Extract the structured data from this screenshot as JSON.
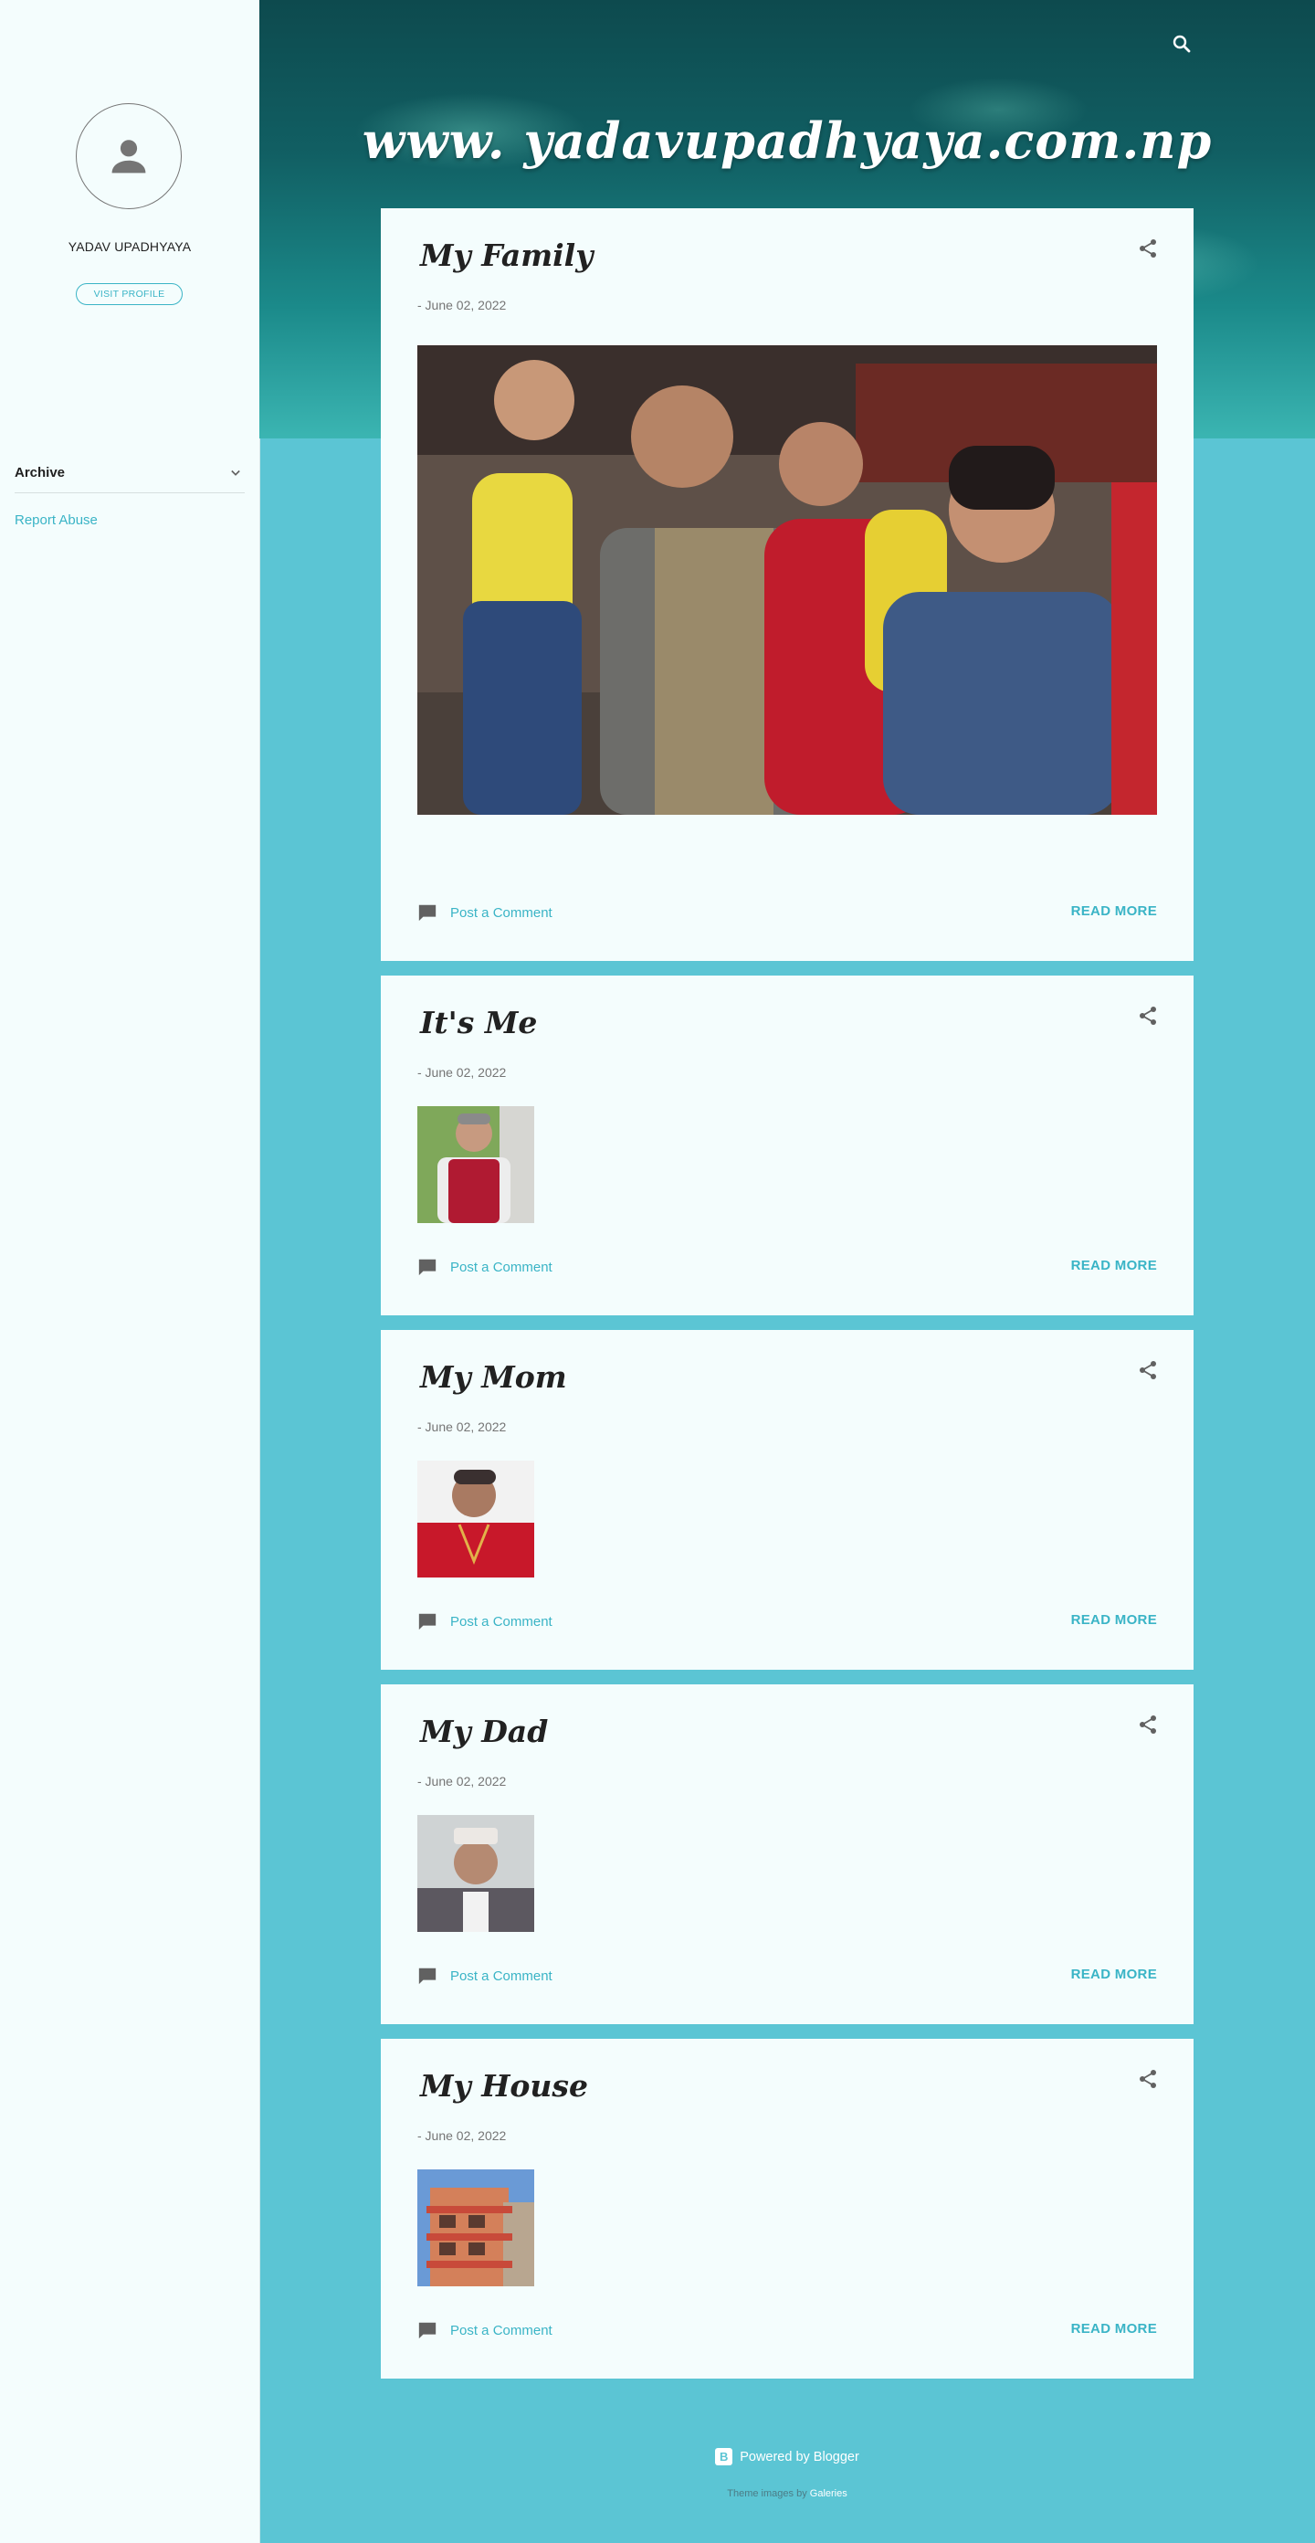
{
  "sidebar": {
    "profile_name": "YADAV UPADHYAYA",
    "visit_profile_label": "VISIT PROFILE",
    "archive_label": "Archive",
    "report_abuse_label": "Report Abuse"
  },
  "header": {
    "site_title": "www. yadavupadhyaya.com.np"
  },
  "posts": [
    {
      "title": "My Family",
      "date": "- June 02, 2022",
      "comment_label": "Post a Comment",
      "read_more_label": "READ MORE"
    },
    {
      "title": "It's Me",
      "date": "- June 02, 2022",
      "comment_label": "Post a Comment",
      "read_more_label": "READ MORE"
    },
    {
      "title": "My Mom",
      "date": "- June 02, 2022",
      "comment_label": "Post a Comment",
      "read_more_label": "READ MORE"
    },
    {
      "title": "My Dad",
      "date": "- June 02, 2022",
      "comment_label": "Post a Comment",
      "read_more_label": "READ MORE"
    },
    {
      "title": "My House",
      "date": "- June 02, 2022",
      "comment_label": "Post a Comment",
      "read_more_label": "READ MORE"
    }
  ],
  "footer": {
    "powered_by": "Powered by Blogger",
    "theme_images_prefix": "Theme images by",
    "theme_images_author": "Galeries"
  },
  "colors": {
    "page_background": "#5bc5d4",
    "sidebar_background": "#f4fdfd",
    "card_background": "#f4fdfd",
    "accent": "#3ab4c6",
    "text": "#212121",
    "muted_text": "#757575"
  },
  "icons": [
    "person-icon",
    "chevron-down-icon",
    "search-icon",
    "share-icon",
    "comment-icon",
    "blogger-icon"
  ]
}
